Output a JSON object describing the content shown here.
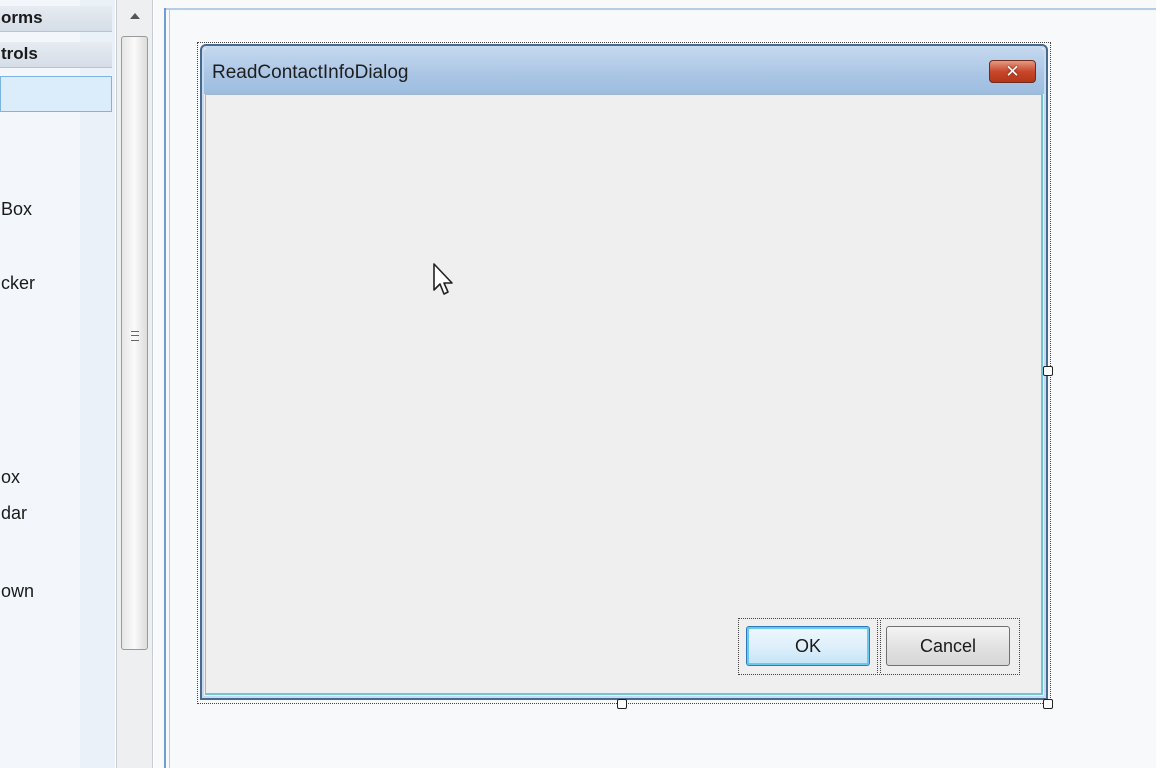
{
  "toolbox": {
    "headers": [
      "orms",
      "trols"
    ],
    "items": [
      "Box",
      "cker",
      "ox",
      "dar",
      "own"
    ]
  },
  "dialog": {
    "title": "ReadContactInfoDialog",
    "close_glyph": "✕",
    "ok_label": "OK",
    "cancel_label": "Cancel"
  },
  "colors": {
    "titlebar": "#a9c5e4",
    "close_button": "#c8472b",
    "ok_focus": "#6ac7ee",
    "dialog_bg": "#efefef"
  }
}
